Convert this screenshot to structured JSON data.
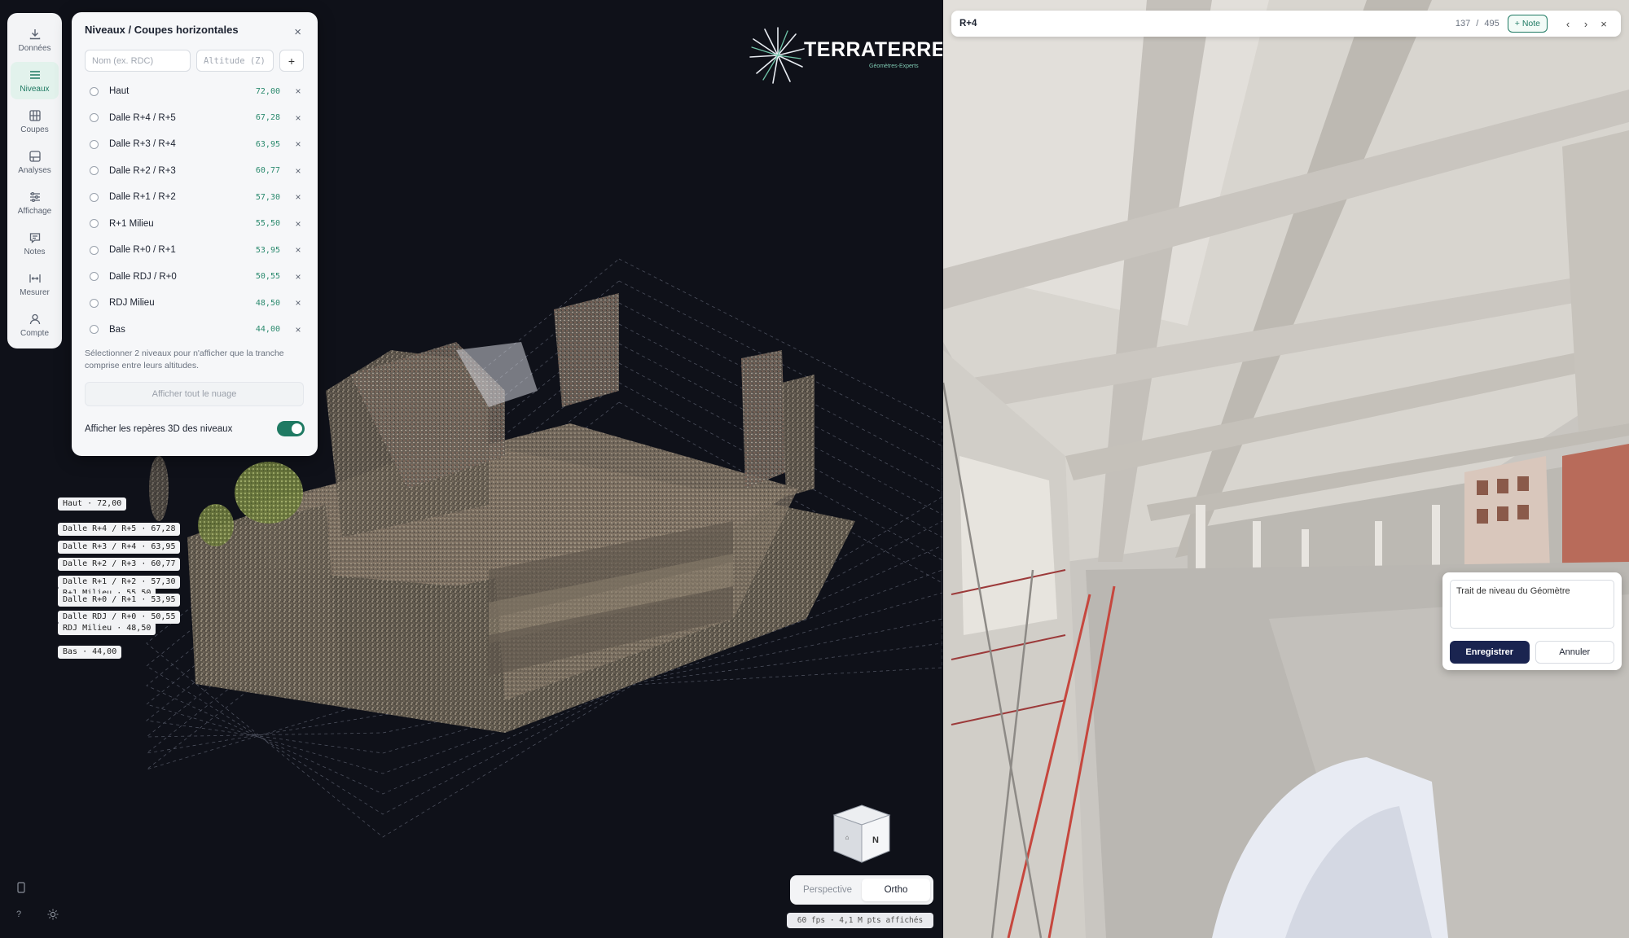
{
  "sidebar": {
    "items": [
      {
        "label": "Données",
        "icon": "download-icon"
      },
      {
        "label": "Niveaux",
        "icon": "list-icon"
      },
      {
        "label": "Coupes",
        "icon": "grid-icon"
      },
      {
        "label": "Analyses",
        "icon": "chart-icon"
      },
      {
        "label": "Affichage",
        "icon": "sliders-icon"
      },
      {
        "label": "Notes",
        "icon": "chat-icon"
      },
      {
        "label": "Mesurer",
        "icon": "ruler-icon"
      },
      {
        "label": "Compte",
        "icon": "user-icon"
      }
    ],
    "active": "Niveaux"
  },
  "levels_panel": {
    "title": "Niveaux / Coupes horizontales",
    "name_placeholder": "Nom (ex. RDC)",
    "altitude_placeholder": "Altitude (Z)",
    "add_label": "+",
    "close_label": "×",
    "levels": [
      {
        "name": "Haut",
        "altitude": "72,00"
      },
      {
        "name": "Dalle R+4 / R+5",
        "altitude": "67,28"
      },
      {
        "name": "Dalle R+3 / R+4",
        "altitude": "63,95"
      },
      {
        "name": "Dalle R+2 / R+3",
        "altitude": "60,77"
      },
      {
        "name": "Dalle R+1 / R+2",
        "altitude": "57,30"
      },
      {
        "name": "R+1 Milieu",
        "altitude": "55,50"
      },
      {
        "name": "Dalle R+0 / R+1",
        "altitude": "53,95"
      },
      {
        "name": "Dalle RDJ / R+0",
        "altitude": "50,55"
      },
      {
        "name": "RDJ Milieu",
        "altitude": "48,50"
      },
      {
        "name": "Bas",
        "altitude": "44,00"
      }
    ],
    "delete_label": "×",
    "hint": "Sélectionner 2 niveaux pour n'afficher que la tranche comprise entre leurs altitudes.",
    "show_all_label": "Afficher tout le nuage",
    "toggle_label": "Afficher les repères 3D des niveaux",
    "toggle_on": true
  },
  "level_tags": [
    "Haut · 72,00",
    "Dalle R+4 / R+5 · 67,28",
    "Dalle R+3 / R+4 · 63,95",
    "Dalle R+2 / R+3 · 60,77",
    "Dalle R+1 / R+2 · 57,30",
    "R+1 Milieu · 55,50",
    "Dalle R+0 / R+1 · 53,95",
    "Dalle RDJ / R+0 · 50,55",
    "RDJ Milieu · 48,50",
    "Bas · 44,00"
  ],
  "logo": {
    "name": "TERRATERRE",
    "tagline": "Géomètres-Experts"
  },
  "navcube": {
    "face_label": "N"
  },
  "view_mode": {
    "options": [
      "Perspective",
      "Ortho"
    ],
    "active": "Ortho"
  },
  "status": {
    "fps_text": "60 fps · 4,1 M pts affichés"
  },
  "panorama": {
    "title": "R+4",
    "current": "137",
    "separator": "/",
    "total": "495",
    "note_button": "+ Note",
    "prev": "‹",
    "next": "›",
    "close": "×"
  },
  "note_editor": {
    "text": "Trait de niveau du Géomètre",
    "save_label": "Enregistrer",
    "cancel_label": "Annuler"
  },
  "colors": {
    "accent": "#1f7a63",
    "primary_dark": "#1a2450",
    "altitude_text": "#2b8a6e"
  }
}
